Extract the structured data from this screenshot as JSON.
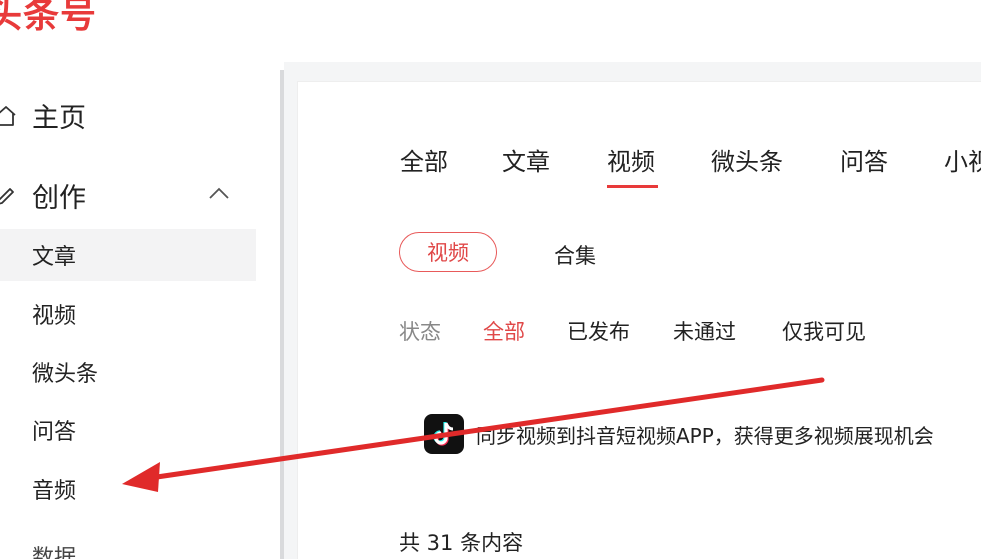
{
  "header": {
    "logo_text": "头条号"
  },
  "sidebar": {
    "home_label": "主页",
    "create_label": "创作",
    "sub_items": [
      {
        "label": "文章"
      },
      {
        "label": "视频"
      },
      {
        "label": "微头条"
      },
      {
        "label": "问答"
      },
      {
        "label": "音频"
      }
    ],
    "more_label": "数据"
  },
  "content": {
    "tabs": [
      "全部",
      "文章",
      "视频",
      "微头条",
      "问答",
      "小视"
    ],
    "active_tab": "视频",
    "subtabs": {
      "video_label": "视频",
      "collection_label": "合集"
    },
    "filters": {
      "label": "状态",
      "options": [
        "全部",
        "已发布",
        "未通过",
        "仅我可见"
      ],
      "active": "全部"
    },
    "banner": {
      "text": "同步视频到抖音短视频APP，获得更多视频展现机会"
    },
    "count_text": "共 31 条内容"
  },
  "colors": {
    "accent": "#e83a3a",
    "arrow": "#e02a2a",
    "divider": "#d9dadc"
  },
  "icons": {
    "home": "home-icon",
    "create": "edit-icon",
    "collapse": "chevron-up-icon",
    "douyin": "tiktok-icon"
  }
}
